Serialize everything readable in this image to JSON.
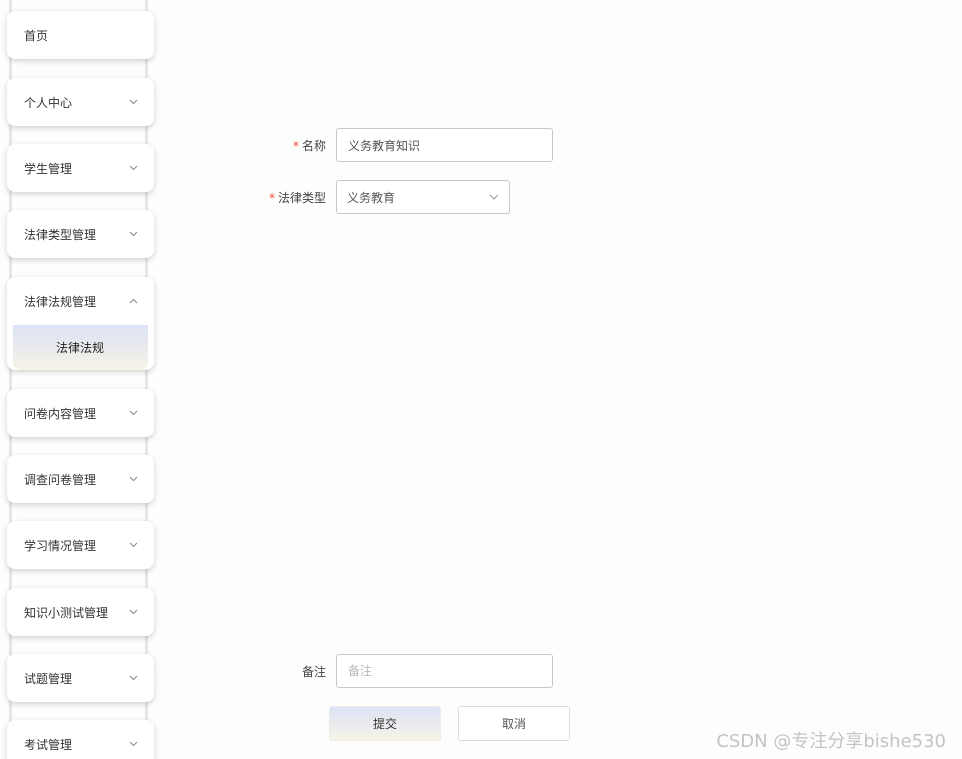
{
  "sidebar": {
    "items": [
      {
        "label": "首页"
      },
      {
        "label": "个人中心"
      },
      {
        "label": "学生管理"
      },
      {
        "label": "法律类型管理"
      },
      {
        "label": "法律法规管理",
        "children": [
          {
            "label": "法律法规"
          }
        ]
      },
      {
        "label": "问卷内容管理"
      },
      {
        "label": "调查问卷管理"
      },
      {
        "label": "学习情况管理"
      },
      {
        "label": "知识小测试管理"
      },
      {
        "label": "试题管理"
      },
      {
        "label": "考试管理"
      }
    ]
  },
  "form": {
    "required_mark": "*",
    "name": {
      "label": "名称",
      "value": "义务教育知识"
    },
    "law_type": {
      "label": "法律类型",
      "value": "义务教育"
    },
    "remark": {
      "label": "备注",
      "placeholder": "备注"
    },
    "submit_label": "提交",
    "cancel_label": "取消"
  },
  "watermark": "CSDN @专注分享bishe530",
  "colors": {
    "required": "#e54d42",
    "active_gradient_top": "#dde3f6",
    "active_gradient_bottom": "#f6f2e6"
  }
}
